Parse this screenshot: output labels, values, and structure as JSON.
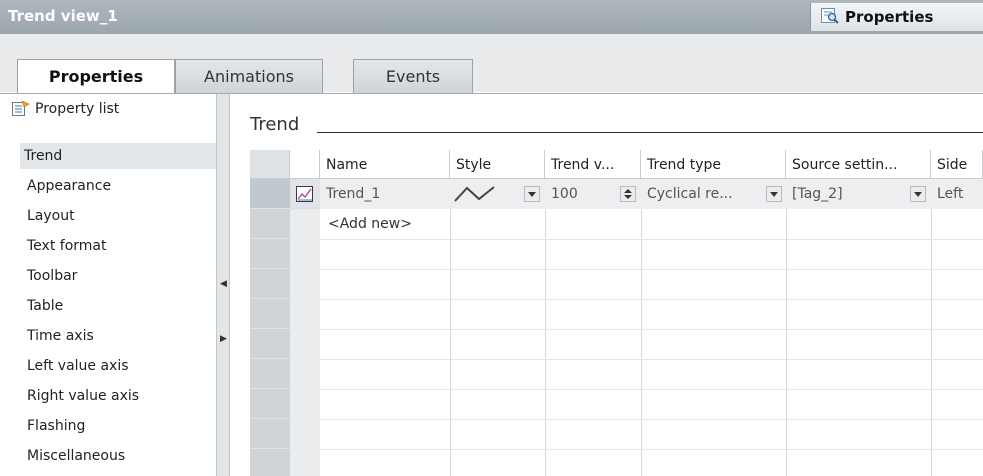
{
  "window": {
    "title": "Trend view_1",
    "properties_tab": "Properties"
  },
  "tabs": [
    {
      "label": "Properties",
      "active": true
    },
    {
      "label": "Animations",
      "active": false
    },
    {
      "label": "Events",
      "active": false
    }
  ],
  "sidebar": {
    "property_list_label": "Property list",
    "items": [
      {
        "label": "Trend",
        "selected": true
      },
      {
        "label": "Appearance"
      },
      {
        "label": "Layout"
      },
      {
        "label": "Text format"
      },
      {
        "label": "Toolbar"
      },
      {
        "label": "Table"
      },
      {
        "label": "Time axis"
      },
      {
        "label": "Left value axis"
      },
      {
        "label": "Right value axis"
      },
      {
        "label": "Flashing"
      },
      {
        "label": "Miscellaneous"
      }
    ]
  },
  "section": {
    "title": "Trend"
  },
  "table": {
    "columns": [
      "Name",
      "Style",
      "Trend v...",
      "Trend type",
      "Source settin...",
      "Side"
    ],
    "rows": [
      {
        "name": "Trend_1",
        "trend_values": "100",
        "trend_type": "Cyclical re...",
        "source": "[Tag_2]",
        "side": "Left"
      }
    ],
    "add_new": "<Add new>"
  },
  "icons": {
    "properties_tab": "magnifier-properties-icon",
    "property_list": "property-list-icon",
    "trend_row": "trend-chart-icon",
    "style_preview": "line-style-icon",
    "dropdown": "dropdown-arrow-icon",
    "spinner": "spinner-updown-icon"
  },
  "colors": {
    "titlebar": "#a3adb3",
    "selection": "#e3e6e8",
    "row_header": "#cfd3d6",
    "accent_icon": "#3a74c9"
  }
}
